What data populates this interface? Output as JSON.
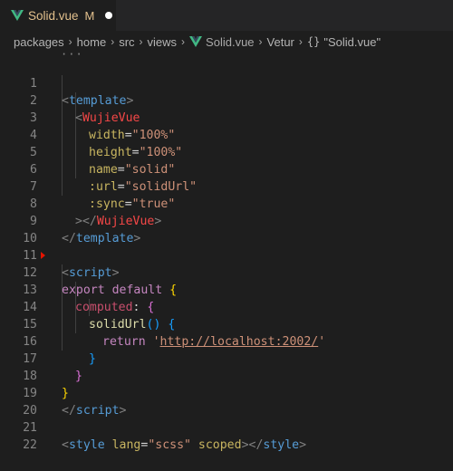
{
  "tab": {
    "title": "Solid.vue",
    "modified": "M"
  },
  "breadcrumb": {
    "items": [
      "packages",
      "home",
      "src",
      "views"
    ],
    "file": "Solid.vue",
    "vetur": "Vetur",
    "symbol_icon": "{}",
    "symbol": "\"Solid.vue\""
  },
  "editor": {
    "fold_hint": "···",
    "line_numbers": [
      "1",
      "2",
      "3",
      "4",
      "5",
      "6",
      "7",
      "8",
      "9",
      "10",
      "11",
      "12",
      "13",
      "14",
      "15",
      "16",
      "17",
      "18",
      "19",
      "20",
      "21",
      "22"
    ],
    "l1": {
      "open": "<",
      "tag": "template",
      "close": ">"
    },
    "l2": {
      "open": "<",
      "tag": "WujieVue"
    },
    "l3": {
      "attr": "width",
      "eq": "=",
      "val": "\"100%\""
    },
    "l4": {
      "attr": "height",
      "eq": "=",
      "val": "\"100%\""
    },
    "l5": {
      "attr": "name",
      "eq": "=",
      "val": "\"solid\""
    },
    "l6": {
      "attr": ":url",
      "eq": "=",
      "val": "\"solidUrl\""
    },
    "l7": {
      "attr": ":sync",
      "eq": "=",
      "val": "\"true\""
    },
    "l8": {
      "a": "></",
      "tag": "WujieVue",
      "b": ">"
    },
    "l9": {
      "a": "</",
      "tag": "template",
      "b": ">"
    },
    "l11": {
      "a": "<",
      "tag": "script",
      "b": ">"
    },
    "l12": {
      "kw": "export default ",
      "brace": "{"
    },
    "l13": {
      "key": "computed",
      "colon": ": ",
      "brace": "{"
    },
    "l14": {
      "fn": "solidUrl",
      "paren": "()",
      "space": " ",
      "brace": "{"
    },
    "l15": {
      "kw": "return ",
      "q1": "'",
      "url": "http://localhost:2002/",
      "q2": "'"
    },
    "l16": {
      "brace": "}"
    },
    "l17": {
      "brace": "}"
    },
    "l18": {
      "brace": "}"
    },
    "l19": {
      "a": "</",
      "tag": "script",
      "b": ">"
    },
    "l21": {
      "a": "<",
      "tag": "style",
      "sp": " ",
      "attr1": "lang",
      "eq": "=",
      "val": "\"scss\"",
      "sp2": " ",
      "attr2": "scoped",
      "c": "></",
      "tag2": "style",
      "d": ">"
    }
  },
  "colors": {
    "background": "#1e1e1e",
    "tab_modified": "#e2c08d",
    "tag": "#569cd6",
    "component": "#f44747",
    "string": "#ce9178"
  }
}
